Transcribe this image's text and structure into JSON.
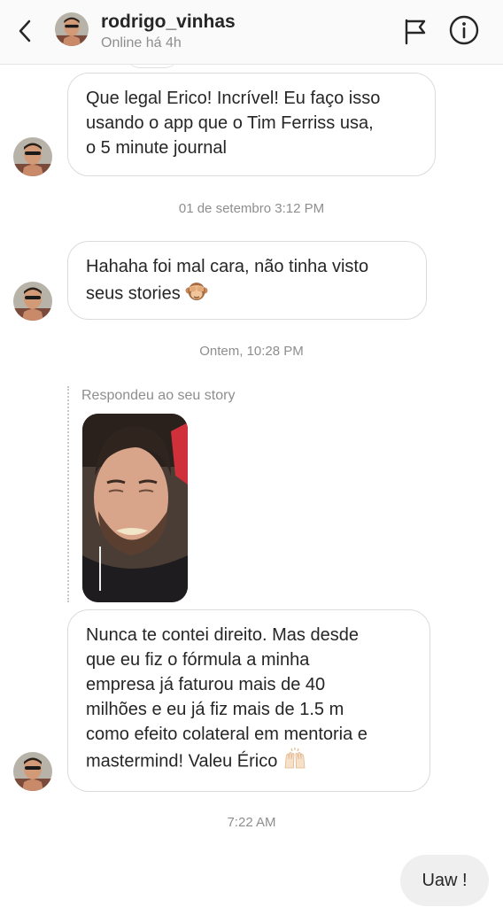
{
  "header": {
    "username": "rodrigo_vinhas",
    "status": "Online há 4h",
    "back_icon": "chevron-left-icon",
    "flag_icon": "flag-icon",
    "info_icon": "info-icon"
  },
  "messages": [
    {
      "text": "Que legal Erico! Incrível! Eu faço isso\nusando o app que o Tim Ferriss usa,\no 5 minute journal",
      "emoji": ""
    },
    {
      "text": "Hahaha foi mal cara, não tinha visto\nseus stories",
      "emoji": "see-no-evil-monkey-emoji"
    },
    {
      "text": "Nunca te contei direito. Mas desde\nque eu fiz o fórmula a minha\nempresa já faturou mais de 40\nmilhões e eu já fiz mais de 1.5 m\ncomo efeito colateral em mentoria e\nmastermind! Valeu Érico",
      "emoji": "raising-hands-emoji"
    }
  ],
  "timestamps": [
    "01 de setembro 3:12 PM",
    "Ontem, 10:28 PM",
    "7:22 AM"
  ],
  "story_reply": {
    "label": "Respondeu ao seu story"
  },
  "sent": {
    "text": "Uaw !"
  },
  "colors": {
    "bubble_border": "#dbdbdb",
    "sent_bg": "#efefef",
    "meta_text": "#8e8e8e"
  }
}
